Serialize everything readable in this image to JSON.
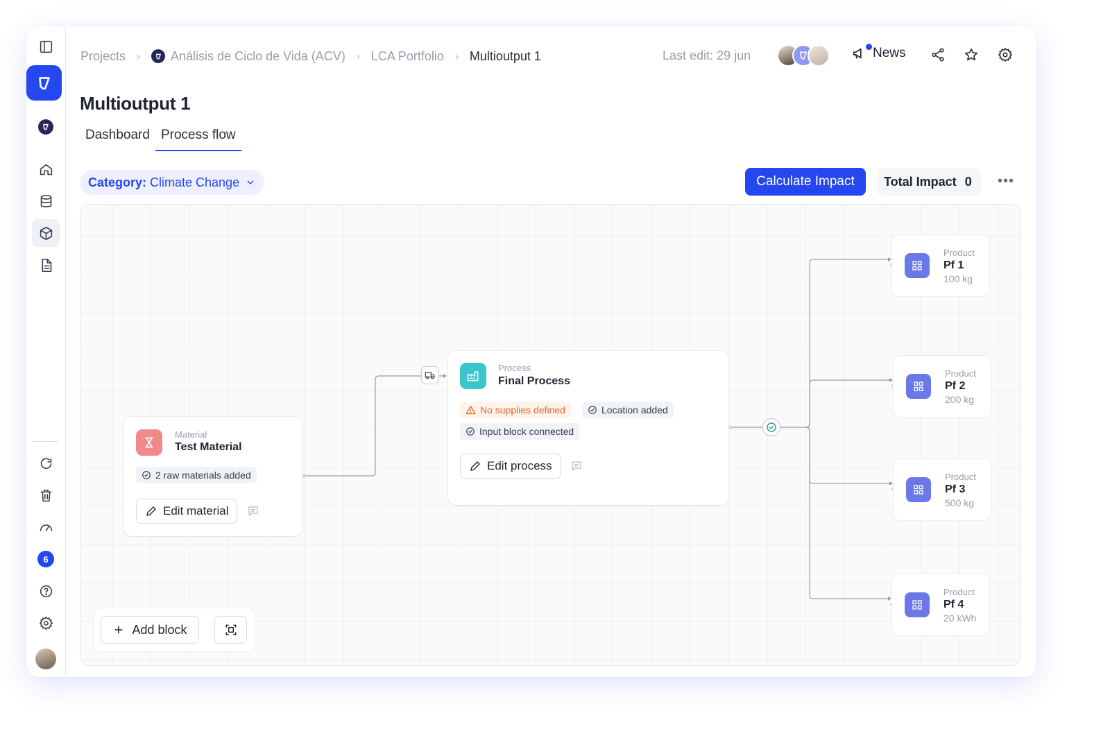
{
  "breadcrumb": {
    "items": [
      "Projects",
      "Análisis de Ciclo de Vida (ACV)",
      "LCA Portfolio",
      "Multioutput 1"
    ]
  },
  "header": {
    "last_edit": "Last edit: 29 jun",
    "news_label": "News"
  },
  "page": {
    "title": "Multioutput 1",
    "tabs": [
      {
        "label": "Dashboard",
        "active": false
      },
      {
        "label": "Process flow",
        "active": true
      }
    ]
  },
  "toolbar": {
    "category_label": "Category:",
    "category_value": "Climate Change",
    "calculate_label": "Calculate Impact",
    "total_label": "Total Impact",
    "total_value": "0"
  },
  "sidebar": {
    "badge_count": "6"
  },
  "flow": {
    "material": {
      "type": "Material",
      "title": "Test Material",
      "chip": "2 raw materials added",
      "edit_label": "Edit material"
    },
    "process": {
      "type": "Process",
      "title": "Final Process",
      "chips": [
        "No supplies defined",
        "Location added",
        "Input block connected"
      ],
      "edit_label": "Edit process"
    },
    "products": [
      {
        "type": "Product",
        "name": "Pf 1",
        "qty": "100 kg"
      },
      {
        "type": "Product",
        "name": "Pf 2",
        "qty": "200 kg"
      },
      {
        "type": "Product",
        "name": "Pf 3",
        "qty": "500 kg"
      },
      {
        "type": "Product",
        "name": "Pf 4",
        "qty": "20 kWh"
      }
    ],
    "add_block_label": "Add block"
  },
  "colors": {
    "accent": "#2447f0",
    "warning": "#e0672a",
    "material_icon": "#f08a8a",
    "process_icon": "#3cc6cc",
    "product_icon": "#6b78e8"
  }
}
